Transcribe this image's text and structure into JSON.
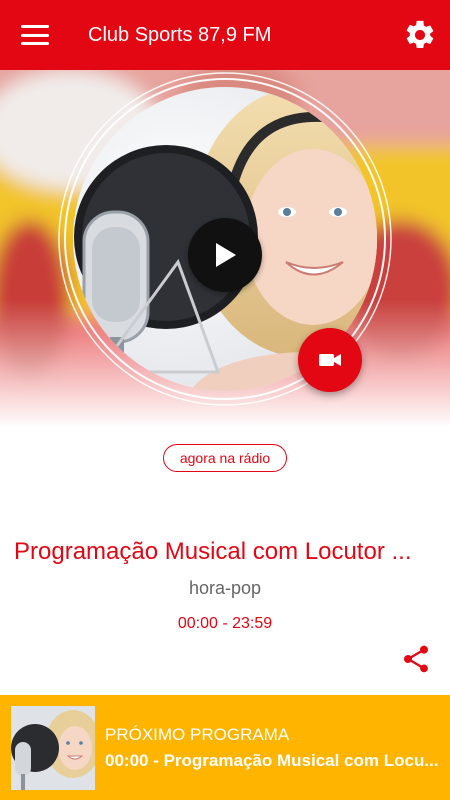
{
  "appbar": {
    "title": "Club Sports 87,9 FM",
    "menu_icon": "menu-icon",
    "settings_icon": "gear-icon"
  },
  "player": {
    "play_icon": "play-icon",
    "video_icon": "video-camera-icon",
    "now_badge": "agora na rádio"
  },
  "program": {
    "title": "Programação Musical com Locutor ...",
    "host": "hora-pop",
    "time": "00:00 - 23:59",
    "share_icon": "share-icon"
  },
  "next": {
    "label": "PRÓXIMO PROGRAMA",
    "title": "00:00 - Programação Musical com Locu..."
  },
  "colors": {
    "primary": "#e30613",
    "accent_bar": "#ffb400",
    "text_gray": "#666666"
  }
}
